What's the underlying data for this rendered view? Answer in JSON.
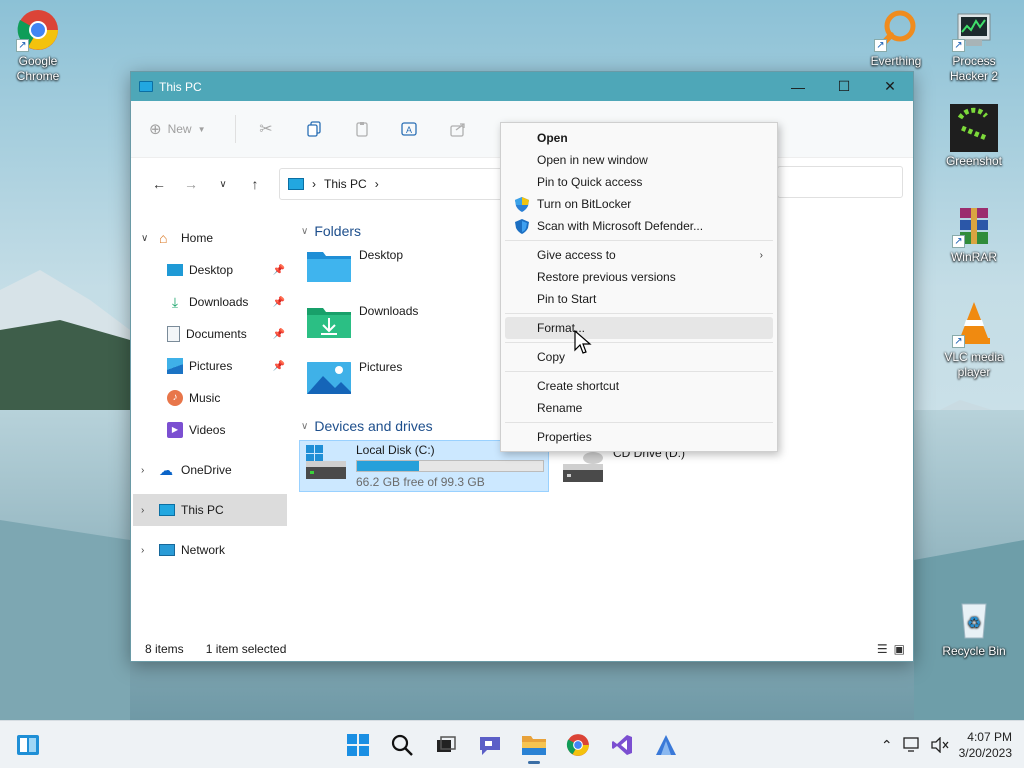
{
  "desktop": {
    "icons": [
      {
        "label": "Google Chrome",
        "icon": "chrome-icon"
      },
      {
        "label": "Everthing",
        "icon": "everything-search-icon"
      },
      {
        "label": "Process Hacker 2",
        "icon": "process-hacker-icon"
      },
      {
        "label": "Greenshot",
        "icon": "greenshot-icon"
      },
      {
        "label": "WinRAR",
        "icon": "winrar-icon"
      },
      {
        "label": "VLC media player",
        "icon": "vlc-icon"
      },
      {
        "label": "Recycle Bin",
        "icon": "recycle-bin-icon"
      }
    ]
  },
  "window": {
    "title": "This PC",
    "controls": {
      "minimize": "—",
      "maximize": "☐",
      "close": "✕"
    },
    "ribbon": {
      "new_label": "New",
      "buttons": [
        "cut-icon",
        "copy-icon",
        "paste-icon",
        "rename-icon",
        "share-icon",
        "delete-icon"
      ]
    },
    "address": {
      "root": "This PC",
      "separator": "›"
    },
    "sidebar": {
      "items": [
        {
          "label": "Home",
          "icon": "home-icon"
        },
        {
          "label": "Desktop",
          "icon": "desktop-icon",
          "pinned": true
        },
        {
          "label": "Downloads",
          "icon": "downloads-icon",
          "pinned": true
        },
        {
          "label": "Documents",
          "icon": "documents-icon",
          "pinned": true
        },
        {
          "label": "Pictures",
          "icon": "pictures-icon",
          "pinned": true
        },
        {
          "label": "Music",
          "icon": "music-icon"
        },
        {
          "label": "Videos",
          "icon": "videos-icon"
        },
        {
          "label": "OneDrive",
          "icon": "onedrive-icon"
        },
        {
          "label": "This PC",
          "icon": "this-pc-icon"
        },
        {
          "label": "Network",
          "icon": "network-icon"
        }
      ]
    },
    "sections": {
      "folders": "Folders",
      "devices": "Devices and drives"
    },
    "folders": [
      {
        "label": "Desktop"
      },
      {
        "label": "Downloads"
      },
      {
        "label": "Pictures"
      }
    ],
    "drives": [
      {
        "label": "Local Disk (C:)",
        "free_text": "66.2 GB free of 99.3 GB",
        "used_fraction": 0.333
      },
      {
        "label": "CD Drive (D:)"
      }
    ],
    "status": {
      "items": "8 items",
      "selected": "1 item selected"
    }
  },
  "context_menu": {
    "items": [
      {
        "label": "Open"
      },
      {
        "label": "Open in new window"
      },
      {
        "label": "Pin to Quick access"
      },
      {
        "label": "Turn on BitLocker"
      },
      {
        "label": "Scan with Microsoft Defender..."
      },
      {
        "label": "Give access to"
      },
      {
        "label": "Restore previous versions"
      },
      {
        "label": "Pin to Start"
      },
      {
        "label": "Format..."
      },
      {
        "label": "Copy"
      },
      {
        "label": "Create shortcut"
      },
      {
        "label": "Rename"
      },
      {
        "label": "Properties"
      }
    ],
    "submenu_arrow": "›"
  },
  "taskbar": {
    "apps": [
      "start-icon",
      "search-icon",
      "task-view-icon",
      "chat-icon",
      "file-explorer-icon",
      "chrome-icon",
      "visual-studio-icon",
      "other-app-icon"
    ],
    "widgets_icon": "widgets-icon",
    "tray": {
      "chevron": "⌃"
    },
    "clock": {
      "time": "4:07 PM",
      "date": "3/20/2023"
    }
  },
  "colors": {
    "titlebar": "#4ea7b8",
    "accent": "#0067c0",
    "selection": "#cce8ff"
  }
}
